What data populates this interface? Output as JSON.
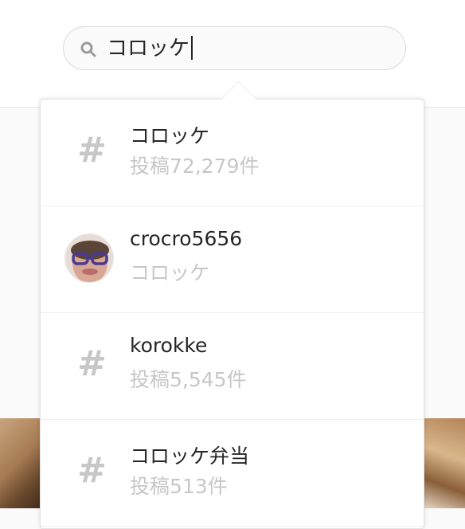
{
  "search": {
    "value": "コロッケ",
    "icon": "search-icon"
  },
  "results": [
    {
      "type": "hashtag",
      "icon": "hashtag-icon",
      "icon_glyph": "#",
      "title": "コロッケ",
      "subtitle": "投稿72,279件"
    },
    {
      "type": "user",
      "icon": "avatar",
      "title": "crocro5656",
      "subtitle": "コロッケ"
    },
    {
      "type": "hashtag",
      "icon": "hashtag-icon",
      "icon_glyph": "#",
      "title": "korokke",
      "subtitle": "投稿5,545件"
    },
    {
      "type": "hashtag",
      "icon": "hashtag-icon",
      "icon_glyph": "#",
      "title": "コロッケ弁当",
      "subtitle": "投稿513件"
    }
  ],
  "colors": {
    "primary_text": "#262626",
    "secondary_text": "#c7c7c7",
    "border": "#dbdbdb",
    "background": "#fafafa"
  }
}
